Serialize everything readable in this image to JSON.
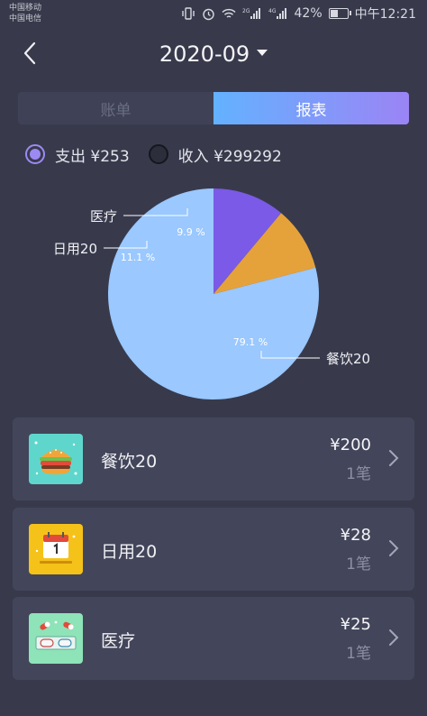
{
  "status_bar": {
    "carrier_1": "中国移动",
    "carrier_2": "中国电信",
    "net_1": "2G",
    "net_2": "4G",
    "battery": "42%",
    "time": "中午12:21"
  },
  "header": {
    "month": "2020-09"
  },
  "tabs": [
    {
      "label": "账单",
      "active": false
    },
    {
      "label": "报表",
      "active": true
    }
  ],
  "type_toggle": {
    "expense_label": "支出 ¥253",
    "income_label": "收入 ¥299292",
    "selected": "expense"
  },
  "chart_data": {
    "type": "pie",
    "slices": [
      {
        "label": "餐饮20",
        "value": 79.1,
        "pct_label": "79.1 %",
        "color": "#9ac8ff"
      },
      {
        "label": "日用20",
        "value": 11.1,
        "pct_label": "11.1 %",
        "color": "#7a5ae6"
      },
      {
        "label": "医疗",
        "value": 9.9,
        "pct_label": "9.9 %",
        "color": "#e6a23a"
      }
    ]
  },
  "categories": [
    {
      "name": "餐饮20",
      "amount": "¥200",
      "count": "1笔",
      "icon": "burger-icon",
      "icon_bg": "#5fd6cc"
    },
    {
      "name": "日用20",
      "amount": "¥28",
      "count": "1笔",
      "icon": "calendar-icon",
      "icon_bg": "#f5c21a"
    },
    {
      "name": "医疗",
      "amount": "¥25",
      "count": "1笔",
      "icon": "pill-icon",
      "icon_bg": "#8ee3b8"
    }
  ]
}
